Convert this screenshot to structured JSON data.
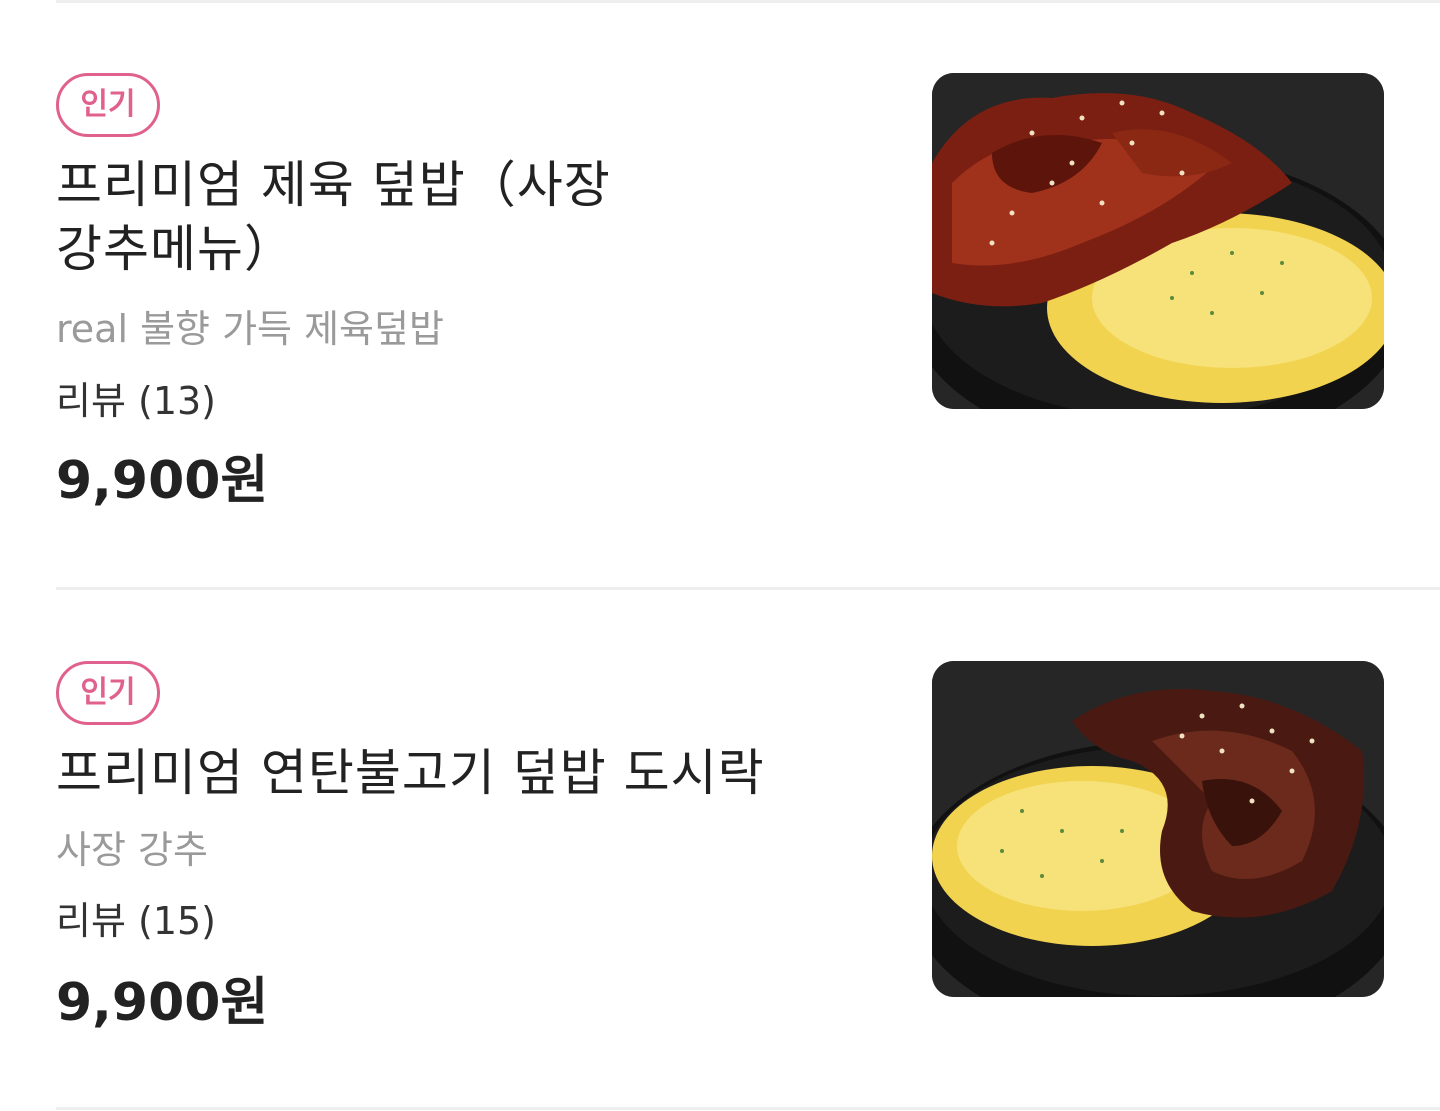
{
  "menu": {
    "items": [
      {
        "badge": "인기",
        "title_line1": "프리미엄 제육 덮밥（사장",
        "title_line2": "강추메뉴）",
        "description": "real 불향 가득 제육덮밥",
        "review_count_label": "리뷰 (13)",
        "price": "9,900원",
        "image_icon": "food-photo-spicy-pork-rice-bowl"
      },
      {
        "badge": "인기",
        "title_line1": "프리미엄  연탄불고기 덮밥 도시락",
        "title_line2": "",
        "description": "사장 강추",
        "review_count_label": "리뷰 (15)",
        "price": "9,900원",
        "image_icon": "food-photo-bulgogi-rice-bowl"
      }
    ]
  },
  "colors": {
    "badge_accent": "#e0618d",
    "description_gray": "#9a9a9a",
    "divider": "#eeeeee"
  }
}
